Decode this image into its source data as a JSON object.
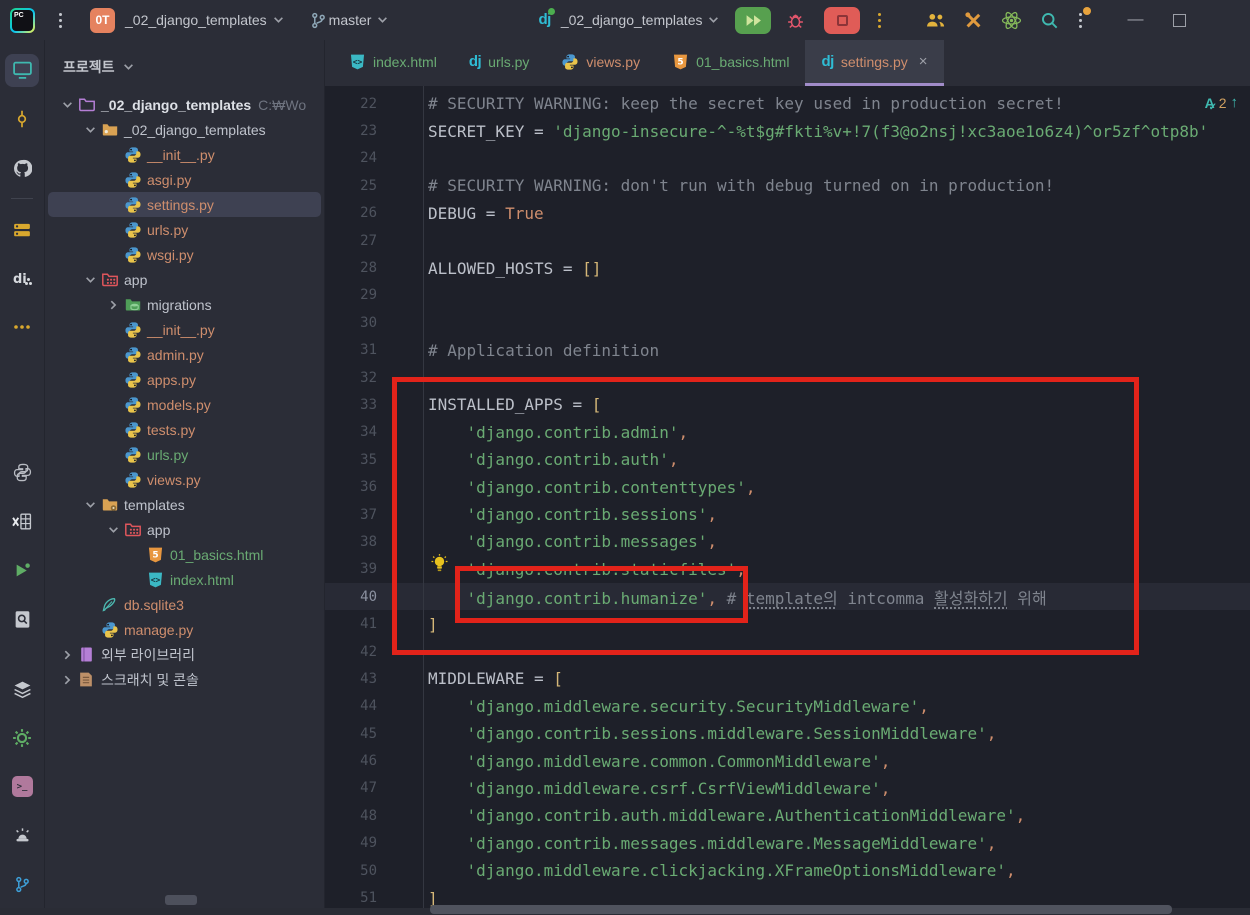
{
  "title_bar": {
    "app": "PyCharm",
    "menu_icon": "kebab-menu",
    "project": {
      "badge": "0T",
      "name": "_02_django_templates"
    },
    "branch": {
      "icon": "git-branch",
      "name": "master"
    },
    "run": {
      "icon": "django-dj",
      "status_dot_color": "#4cae4f",
      "name": "_02_django_templates",
      "buttons": [
        "rerun",
        "debug",
        "stop",
        "more-actions"
      ]
    },
    "right_icons": [
      "code-with-me-users",
      "build-tools",
      "atom",
      "search-everywhere",
      "settings-kebab-with-badge",
      "minimize",
      "maximize"
    ]
  },
  "activity_bar": {
    "top_icons": [
      "project-monitor",
      "commit",
      "github",
      "structure-rows",
      "django-di",
      "more-dots",
      "python",
      "excel-table",
      "run-play",
      "find-in-file",
      "layers"
    ],
    "bottom_icons": [
      "services-gear",
      "terminal",
      "problems-siren",
      "git-branch"
    ]
  },
  "project_panel": {
    "header": "프로젝트",
    "tree": [
      {
        "label": "_02_django_templates",
        "suffix": "C:₩Wo",
        "icon": "folder-purple",
        "level": 0,
        "chev": "down",
        "cls": "bold"
      },
      {
        "label": "_02_django_templates",
        "icon": "folder-src",
        "level": 1,
        "chev": "down",
        "cls": ""
      },
      {
        "label": "__init__.py",
        "icon": "py",
        "level": 2,
        "chev": "",
        "cls": "salmon"
      },
      {
        "label": "asgi.py",
        "icon": "py",
        "level": 2,
        "chev": "",
        "cls": "salmon"
      },
      {
        "label": "settings.py",
        "icon": "py",
        "level": 2,
        "chev": "",
        "cls": "salmon",
        "selected": true
      },
      {
        "label": "urls.py",
        "icon": "py",
        "level": 2,
        "chev": "",
        "cls": "salmon"
      },
      {
        "label": "wsgi.py",
        "icon": "py",
        "level": 2,
        "chev": "",
        "cls": "salmon"
      },
      {
        "label": "app",
        "icon": "folder-app",
        "level": 1,
        "chev": "down",
        "cls": ""
      },
      {
        "label": "migrations",
        "icon": "folder-mig",
        "level": 2,
        "chev": "right",
        "cls": ""
      },
      {
        "label": "__init__.py",
        "icon": "py",
        "level": 2,
        "chev": "",
        "cls": "salmon"
      },
      {
        "label": "admin.py",
        "icon": "py",
        "level": 2,
        "chev": "",
        "cls": "salmon"
      },
      {
        "label": "apps.py",
        "icon": "py",
        "level": 2,
        "chev": "",
        "cls": "salmon"
      },
      {
        "label": "models.py",
        "icon": "py",
        "level": 2,
        "chev": "",
        "cls": "salmon"
      },
      {
        "label": "tests.py",
        "icon": "py",
        "level": 2,
        "chev": "",
        "cls": "salmon"
      },
      {
        "label": "urls.py",
        "icon": "py",
        "level": 2,
        "chev": "",
        "cls": "green"
      },
      {
        "label": "views.py",
        "icon": "py",
        "level": 2,
        "chev": "",
        "cls": "salmon"
      },
      {
        "label": "templates",
        "icon": "folder-tpl",
        "level": 1,
        "chev": "down",
        "cls": ""
      },
      {
        "label": "app",
        "icon": "folder-app",
        "level": 2,
        "chev": "down",
        "cls": ""
      },
      {
        "label": "01_basics.html",
        "icon": "html5",
        "level": 3,
        "chev": "",
        "cls": "green"
      },
      {
        "label": "index.html",
        "icon": "htmlx",
        "level": 3,
        "chev": "",
        "cls": "green"
      },
      {
        "label": "db.sqlite3",
        "icon": "feather",
        "level": 1,
        "chev": "",
        "cls": "salmon"
      },
      {
        "label": "manage.py",
        "icon": "py",
        "level": 1,
        "chev": "",
        "cls": "salmon"
      },
      {
        "label": "외부 라이브러리",
        "icon": "book",
        "level": 0,
        "chev": "right",
        "cls": ""
      },
      {
        "label": "스크래치 및 콘솔",
        "icon": "scratch",
        "level": 0,
        "chev": "right",
        "cls": ""
      }
    ]
  },
  "editor": {
    "tabs": [
      {
        "label": "index.html",
        "icon": "htmlx",
        "color": "green"
      },
      {
        "label": "urls.py",
        "icon": "dj",
        "color": "green"
      },
      {
        "label": "views.py",
        "icon": "py",
        "color": "salmon"
      },
      {
        "label": "01_basics.html",
        "icon": "html5",
        "color": "green"
      },
      {
        "label": "settings.py",
        "icon": "dj",
        "color": "salmon",
        "active": true,
        "close": "×"
      }
    ],
    "inspection": {
      "letter": "A",
      "check": "✓",
      "count": "2",
      "arrow": "↑"
    },
    "current_line": 40,
    "bulb_line": 39,
    "code_lines": [
      {
        "n": 22,
        "s": [
          [
            "# SECURITY WARNING: keep the secret key used in production secret!",
            "cm"
          ]
        ]
      },
      {
        "n": 23,
        "s": [
          [
            "SECRET_KEY",
            "pl"
          ],
          [
            " = ",
            "pl"
          ],
          [
            "'django-insecure-^-%t$g#fkti%v+!7(f3@o2nsj!xc3aoe1o6z4)^or5zf^otp8b'",
            "st"
          ]
        ]
      },
      {
        "n": 24,
        "s": []
      },
      {
        "n": 25,
        "s": [
          [
            "# SECURITY WARNING: don't run with debug turned on in production!",
            "cm"
          ]
        ]
      },
      {
        "n": 26,
        "s": [
          [
            "DEBUG",
            "pl"
          ],
          [
            " = ",
            "pl"
          ],
          [
            "True",
            "kw"
          ]
        ]
      },
      {
        "n": 27,
        "s": []
      },
      {
        "n": 28,
        "s": [
          [
            "ALLOWED_HOSTS",
            "pl"
          ],
          [
            " = ",
            "pl"
          ],
          [
            "[]",
            "br"
          ]
        ]
      },
      {
        "n": 29,
        "s": []
      },
      {
        "n": 30,
        "s": []
      },
      {
        "n": 31,
        "s": [
          [
            "# Application definition",
            "cm"
          ]
        ]
      },
      {
        "n": 32,
        "s": []
      },
      {
        "n": 33,
        "s": [
          [
            "INSTALLED_APPS",
            "pl"
          ],
          [
            " = ",
            "pl"
          ],
          [
            "[",
            "br"
          ]
        ]
      },
      {
        "n": 34,
        "s": [
          [
            "    ",
            "pl"
          ],
          [
            "'django.contrib.admin'",
            "st"
          ],
          [
            ",",
            "cma"
          ]
        ]
      },
      {
        "n": 35,
        "s": [
          [
            "    ",
            "pl"
          ],
          [
            "'django.contrib.auth'",
            "st"
          ],
          [
            ",",
            "cma"
          ]
        ]
      },
      {
        "n": 36,
        "s": [
          [
            "    ",
            "pl"
          ],
          [
            "'django.contrib.contenttypes'",
            "st"
          ],
          [
            ",",
            "cma"
          ]
        ]
      },
      {
        "n": 37,
        "s": [
          [
            "    ",
            "pl"
          ],
          [
            "'django.contrib.sessions'",
            "st"
          ],
          [
            ",",
            "cma"
          ]
        ]
      },
      {
        "n": 38,
        "s": [
          [
            "    ",
            "pl"
          ],
          [
            "'django.contrib.messages'",
            "st"
          ],
          [
            ",",
            "cma"
          ]
        ]
      },
      {
        "n": 39,
        "s": [
          [
            "    ",
            "pl"
          ],
          [
            "'django.contrib.staticfiles'",
            "st"
          ],
          [
            ",",
            "cma"
          ]
        ]
      },
      {
        "n": 40,
        "s": [
          [
            "    ",
            "pl"
          ],
          [
            "'django.contrib.humanize'",
            "st"
          ],
          [
            ",",
            "cma"
          ],
          [
            " ",
            "pl"
          ],
          [
            "# ",
            "cm"
          ],
          [
            "template의",
            "cm u"
          ],
          [
            " intcomma ",
            "cm"
          ],
          [
            "활성화하기",
            "cm u"
          ],
          [
            " 위해",
            "cm"
          ]
        ]
      },
      {
        "n": 41,
        "s": [
          [
            "]",
            "br"
          ]
        ]
      },
      {
        "n": 42,
        "s": []
      },
      {
        "n": 43,
        "s": [
          [
            "MIDDLEWARE",
            "pl"
          ],
          [
            " = ",
            "pl"
          ],
          [
            "[",
            "br"
          ]
        ]
      },
      {
        "n": 44,
        "s": [
          [
            "    ",
            "pl"
          ],
          [
            "'django.middleware.security.SecurityMiddleware'",
            "st"
          ],
          [
            ",",
            "cma"
          ]
        ]
      },
      {
        "n": 45,
        "s": [
          [
            "    ",
            "pl"
          ],
          [
            "'django.contrib.sessions.middleware.SessionMiddleware'",
            "st"
          ],
          [
            ",",
            "cma"
          ]
        ]
      },
      {
        "n": 46,
        "s": [
          [
            "    ",
            "pl"
          ],
          [
            "'django.middleware.common.CommonMiddleware'",
            "st"
          ],
          [
            ",",
            "cma"
          ]
        ]
      },
      {
        "n": 47,
        "s": [
          [
            "    ",
            "pl"
          ],
          [
            "'django.middleware.csrf.CsrfViewMiddleware'",
            "st"
          ],
          [
            ",",
            "cma"
          ]
        ]
      },
      {
        "n": 48,
        "s": [
          [
            "    ",
            "pl"
          ],
          [
            "'django.contrib.auth.middleware.AuthenticationMiddleware'",
            "st"
          ],
          [
            ",",
            "cma"
          ]
        ]
      },
      {
        "n": 49,
        "s": [
          [
            "    ",
            "pl"
          ],
          [
            "'django.contrib.messages.middleware.MessageMiddleware'",
            "st"
          ],
          [
            ",",
            "cma"
          ]
        ]
      },
      {
        "n": 50,
        "s": [
          [
            "    ",
            "pl"
          ],
          [
            "'django.middleware.clickjacking.XFrameOptionsMiddleware'",
            "st"
          ],
          [
            ",",
            "cma"
          ]
        ]
      },
      {
        "n": 51,
        "s": [
          [
            "]",
            "br"
          ]
        ]
      }
    ]
  },
  "annotations": {
    "outer_rect_color": "#e2231a",
    "inner_rect_color": "#e2231a"
  },
  "colors": {
    "bg_main": "#2b2d37",
    "bg_editor": "#1e2029",
    "string": "#6aab73",
    "keyword": "#cf8e6d",
    "comment": "#7f848e",
    "accent_tab": "#a18cc9",
    "annotation_red": "#e2231a"
  }
}
